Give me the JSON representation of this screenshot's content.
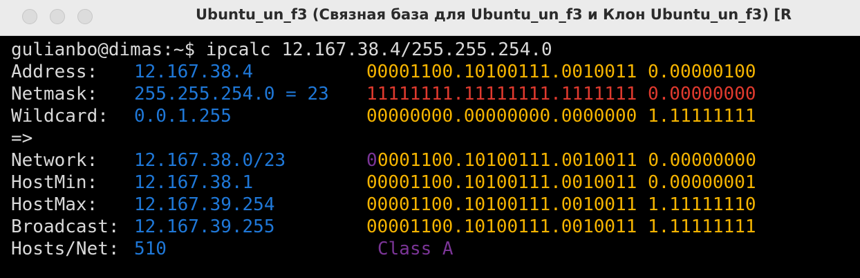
{
  "window": {
    "title": "Ubuntu_un_f3 (Связная база для Ubuntu_un_f3 и Клон Ubuntu_un_f3) [R"
  },
  "terminal": {
    "prompt": "gulianbo@dimas:~$ ipcalc 12.167.38.4/255.255.254.0",
    "rows": [
      {
        "label": "Address:",
        "value": "12.167.38.4",
        "bin_a": "",
        "bin_b": "00001100.10100111.0010011 0.00000100"
      },
      {
        "label": "Netmask:",
        "value": "255.255.254.0 = 23",
        "bin_a": "",
        "bin_b": "11111111.11111111.1111111 0.00000000"
      },
      {
        "label": "Wildcard:",
        "value": "0.0.1.255",
        "bin_a": "",
        "bin_b": "00000000.00000000.0000000 1.11111111"
      },
      {
        "label": "=>",
        "value": "",
        "bin_a": "",
        "bin_b": ""
      },
      {
        "label": "Network:",
        "value": "12.167.38.0/23",
        "bin_a": "0",
        "bin_b": "0001100.10100111.0010011 0.00000000"
      },
      {
        "label": "HostMin:",
        "value": "12.167.38.1",
        "bin_a": "",
        "bin_b": "00001100.10100111.0010011 0.00000001"
      },
      {
        "label": "HostMax:",
        "value": "12.167.39.254",
        "bin_a": "",
        "bin_b": "00001100.10100111.0010011 1.11111110"
      },
      {
        "label": "Broadcast:",
        "value": "12.167.39.255",
        "bin_a": "",
        "bin_b": "00001100.10100111.0010011 1.11111111"
      },
      {
        "label": "Hosts/Net:",
        "value": "510",
        "bin_a": "",
        "bin_b": "",
        "class": "Class A"
      }
    ]
  },
  "colors": {
    "label": "#d9d9d9",
    "value": "#1f78d8",
    "binary": "#f5b400",
    "netmask_binary": "#e03a2e",
    "class": "#7b3597"
  }
}
